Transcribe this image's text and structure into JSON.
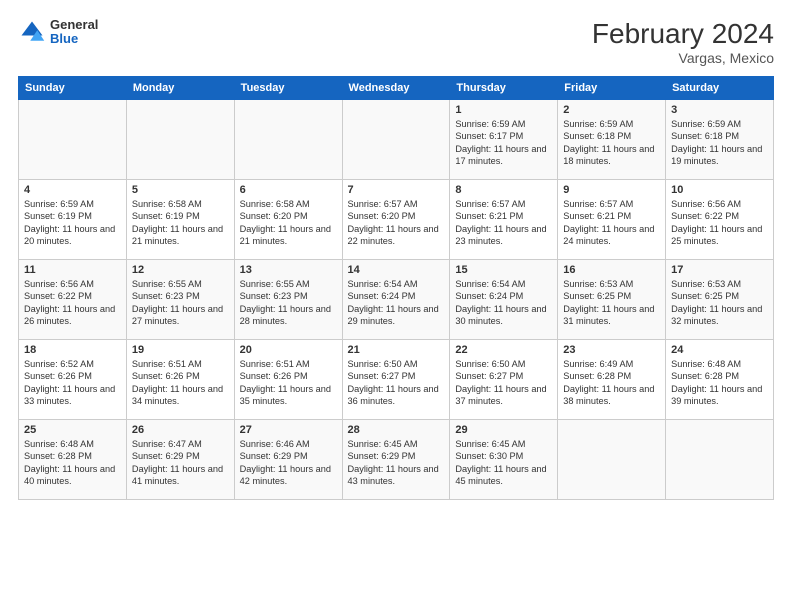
{
  "header": {
    "logo_general": "General",
    "logo_blue": "Blue",
    "title": "February 2024",
    "subtitle": "Vargas, Mexico"
  },
  "days_of_week": [
    "Sunday",
    "Monday",
    "Tuesday",
    "Wednesday",
    "Thursday",
    "Friday",
    "Saturday"
  ],
  "weeks": [
    [
      {
        "day": "",
        "info": ""
      },
      {
        "day": "",
        "info": ""
      },
      {
        "day": "",
        "info": ""
      },
      {
        "day": "",
        "info": ""
      },
      {
        "day": "1",
        "info": "Sunrise: 6:59 AM\nSunset: 6:17 PM\nDaylight: 11 hours\nand 17 minutes."
      },
      {
        "day": "2",
        "info": "Sunrise: 6:59 AM\nSunset: 6:18 PM\nDaylight: 11 hours\nand 18 minutes."
      },
      {
        "day": "3",
        "info": "Sunrise: 6:59 AM\nSunset: 6:18 PM\nDaylight: 11 hours\nand 19 minutes."
      }
    ],
    [
      {
        "day": "4",
        "info": "Sunrise: 6:59 AM\nSunset: 6:19 PM\nDaylight: 11 hours\nand 20 minutes."
      },
      {
        "day": "5",
        "info": "Sunrise: 6:58 AM\nSunset: 6:19 PM\nDaylight: 11 hours\nand 21 minutes."
      },
      {
        "day": "6",
        "info": "Sunrise: 6:58 AM\nSunset: 6:20 PM\nDaylight: 11 hours\nand 21 minutes."
      },
      {
        "day": "7",
        "info": "Sunrise: 6:57 AM\nSunset: 6:20 PM\nDaylight: 11 hours\nand 22 minutes."
      },
      {
        "day": "8",
        "info": "Sunrise: 6:57 AM\nSunset: 6:21 PM\nDaylight: 11 hours\nand 23 minutes."
      },
      {
        "day": "9",
        "info": "Sunrise: 6:57 AM\nSunset: 6:21 PM\nDaylight: 11 hours\nand 24 minutes."
      },
      {
        "day": "10",
        "info": "Sunrise: 6:56 AM\nSunset: 6:22 PM\nDaylight: 11 hours\nand 25 minutes."
      }
    ],
    [
      {
        "day": "11",
        "info": "Sunrise: 6:56 AM\nSunset: 6:22 PM\nDaylight: 11 hours\nand 26 minutes."
      },
      {
        "day": "12",
        "info": "Sunrise: 6:55 AM\nSunset: 6:23 PM\nDaylight: 11 hours\nand 27 minutes."
      },
      {
        "day": "13",
        "info": "Sunrise: 6:55 AM\nSunset: 6:23 PM\nDaylight: 11 hours\nand 28 minutes."
      },
      {
        "day": "14",
        "info": "Sunrise: 6:54 AM\nSunset: 6:24 PM\nDaylight: 11 hours\nand 29 minutes."
      },
      {
        "day": "15",
        "info": "Sunrise: 6:54 AM\nSunset: 6:24 PM\nDaylight: 11 hours\nand 30 minutes."
      },
      {
        "day": "16",
        "info": "Sunrise: 6:53 AM\nSunset: 6:25 PM\nDaylight: 11 hours\nand 31 minutes."
      },
      {
        "day": "17",
        "info": "Sunrise: 6:53 AM\nSunset: 6:25 PM\nDaylight: 11 hours\nand 32 minutes."
      }
    ],
    [
      {
        "day": "18",
        "info": "Sunrise: 6:52 AM\nSunset: 6:26 PM\nDaylight: 11 hours\nand 33 minutes."
      },
      {
        "day": "19",
        "info": "Sunrise: 6:51 AM\nSunset: 6:26 PM\nDaylight: 11 hours\nand 34 minutes."
      },
      {
        "day": "20",
        "info": "Sunrise: 6:51 AM\nSunset: 6:26 PM\nDaylight: 11 hours\nand 35 minutes."
      },
      {
        "day": "21",
        "info": "Sunrise: 6:50 AM\nSunset: 6:27 PM\nDaylight: 11 hours\nand 36 minutes."
      },
      {
        "day": "22",
        "info": "Sunrise: 6:50 AM\nSunset: 6:27 PM\nDaylight: 11 hours\nand 37 minutes."
      },
      {
        "day": "23",
        "info": "Sunrise: 6:49 AM\nSunset: 6:28 PM\nDaylight: 11 hours\nand 38 minutes."
      },
      {
        "day": "24",
        "info": "Sunrise: 6:48 AM\nSunset: 6:28 PM\nDaylight: 11 hours\nand 39 minutes."
      }
    ],
    [
      {
        "day": "25",
        "info": "Sunrise: 6:48 AM\nSunset: 6:28 PM\nDaylight: 11 hours\nand 40 minutes."
      },
      {
        "day": "26",
        "info": "Sunrise: 6:47 AM\nSunset: 6:29 PM\nDaylight: 11 hours\nand 41 minutes."
      },
      {
        "day": "27",
        "info": "Sunrise: 6:46 AM\nSunset: 6:29 PM\nDaylight: 11 hours\nand 42 minutes."
      },
      {
        "day": "28",
        "info": "Sunrise: 6:45 AM\nSunset: 6:29 PM\nDaylight: 11 hours\nand 43 minutes."
      },
      {
        "day": "29",
        "info": "Sunrise: 6:45 AM\nSunset: 6:30 PM\nDaylight: 11 hours\nand 45 minutes."
      },
      {
        "day": "",
        "info": ""
      },
      {
        "day": "",
        "info": ""
      }
    ]
  ]
}
